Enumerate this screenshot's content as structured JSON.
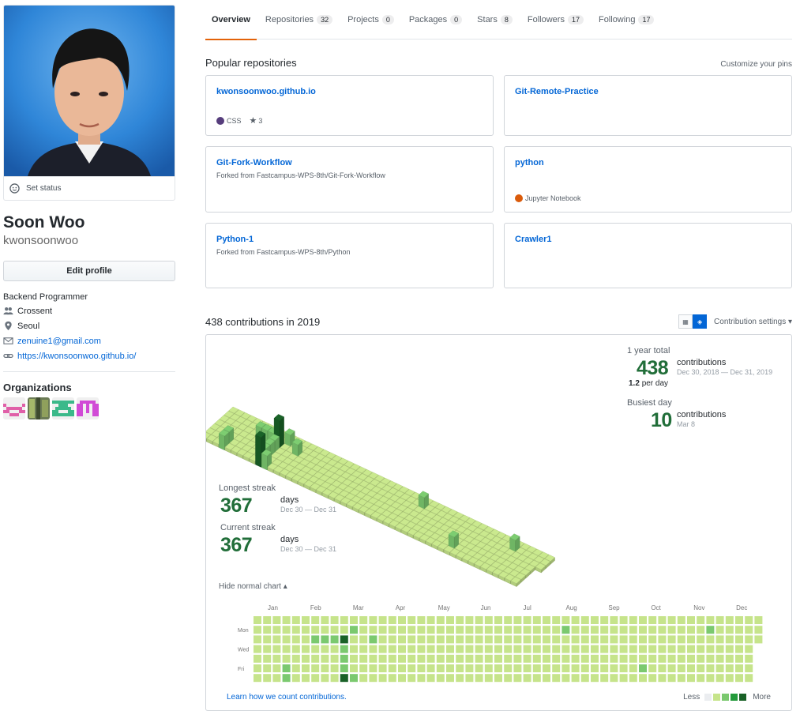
{
  "profile": {
    "set_status": "Set status",
    "display_name": "Soon Woo",
    "login": "kwonsoonwoo",
    "edit_profile": "Edit profile",
    "bio": "Backend Programmer",
    "company": "Crossent",
    "location": "Seoul",
    "email": "zenuine1@gmail.com",
    "website": "https://kwonsoonwoo.github.io/",
    "organizations_title": "Organizations"
  },
  "tabs": [
    {
      "label": "Overview",
      "count": ""
    },
    {
      "label": "Repositories",
      "count": "32"
    },
    {
      "label": "Projects",
      "count": "0"
    },
    {
      "label": "Packages",
      "count": "0"
    },
    {
      "label": "Stars",
      "count": "8"
    },
    {
      "label": "Followers",
      "count": "17"
    },
    {
      "label": "Following",
      "count": "17"
    }
  ],
  "pins": {
    "title": "Popular repositories",
    "customize": "Customize your pins",
    "items": [
      {
        "name": "kwonsoonwoo.github.io",
        "fork": "",
        "language": "CSS",
        "lang_color": "#563d7c",
        "stars": "3"
      },
      {
        "name": "Git-Remote-Practice",
        "fork": "",
        "language": "",
        "lang_color": "",
        "stars": ""
      },
      {
        "name": "Git-Fork-Workflow",
        "fork": "Forked from Fastcampus-WPS-8th/Git-Fork-Workflow",
        "language": "",
        "lang_color": "",
        "stars": ""
      },
      {
        "name": "python",
        "fork": "",
        "language": "Jupyter Notebook",
        "lang_color": "#DA5B0B",
        "stars": ""
      },
      {
        "name": "Python-1",
        "fork": "Forked from Fastcampus-WPS-8th/Python",
        "language": "",
        "lang_color": "",
        "stars": ""
      },
      {
        "name": "Crawler1",
        "fork": "",
        "language": "",
        "lang_color": "",
        "stars": ""
      }
    ]
  },
  "contrib": {
    "title": "438 contributions in 2019",
    "settings": "Contribution settings ▾",
    "total_label": "1 year total",
    "total": "438",
    "total_unit": "contributions",
    "total_range": "Dec 30, 2018 — Dec 31, 2019",
    "per_day_value": "1.2",
    "per_day_unit": "per day",
    "busiest_label": "Busiest day",
    "busiest": "10",
    "busiest_unit": "contributions",
    "busiest_date": "Mar 8",
    "longest_label": "Longest streak",
    "longest": "367",
    "longest_unit": "days",
    "longest_range": "Dec 30 — Dec 31",
    "current_label": "Current streak",
    "current": "367",
    "current_unit": "days",
    "current_range": "Dec 30 — Dec 31",
    "hide_chart": "Hide normal chart ▴",
    "learn": "Learn how we count contributions.",
    "legend_less": "Less",
    "legend_more": "More",
    "months": [
      "Jan",
      "Feb",
      "Mar",
      "Apr",
      "May",
      "Jun",
      "Jul",
      "Aug",
      "Sep",
      "Oct",
      "Nov",
      "Dec"
    ],
    "weekdays": [
      "Mon",
      "Wed",
      "Fri"
    ],
    "weeks": 53,
    "palette": [
      "#ebedf0",
      "#c6e48b",
      "#7bc96f",
      "#239a3b",
      "#196127"
    ],
    "highlights": [
      {
        "week": 6,
        "day": 2,
        "level": 2
      },
      {
        "week": 7,
        "day": 2,
        "level": 2
      },
      {
        "week": 8,
        "day": 2,
        "level": 2
      },
      {
        "week": 9,
        "day": 2,
        "level": 4
      },
      {
        "week": 9,
        "day": 3,
        "level": 2
      },
      {
        "week": 9,
        "day": 4,
        "level": 2
      },
      {
        "week": 9,
        "day": 5,
        "level": 2
      },
      {
        "week": 9,
        "day": 6,
        "level": 4
      },
      {
        "week": 10,
        "day": 1,
        "level": 2
      },
      {
        "week": 10,
        "day": 6,
        "level": 2
      },
      {
        "week": 12,
        "day": 2,
        "level": 2
      },
      {
        "week": 3,
        "day": 5,
        "level": 2
      },
      {
        "week": 3,
        "day": 6,
        "level": 2
      },
      {
        "week": 32,
        "day": 1,
        "level": 2
      },
      {
        "week": 40,
        "day": 5,
        "level": 2
      },
      {
        "week": 47,
        "day": 1,
        "level": 2
      }
    ]
  }
}
